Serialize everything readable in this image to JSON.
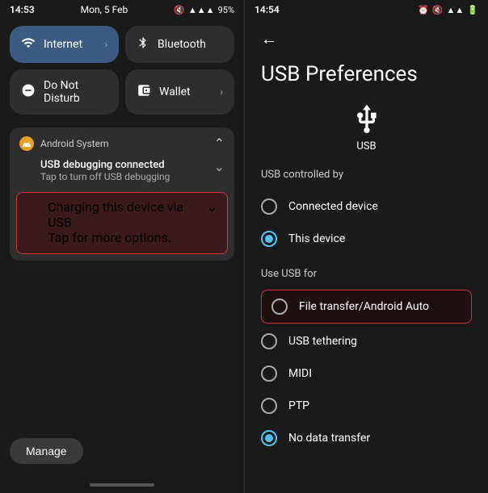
{
  "left": {
    "statusBar": {
      "time": "14:53",
      "date": "Mon, 5 Feb",
      "battery": "95%",
      "icons": "🔇📶🔋"
    },
    "tiles": [
      {
        "id": "internet",
        "icon": "wifi",
        "label": "Internet",
        "arrow": true
      },
      {
        "id": "bluetooth",
        "icon": "bluetooth",
        "label": "Bluetooth",
        "arrow": false
      },
      {
        "id": "donotdisturb",
        "icon": "dnd",
        "label": "Do Not Disturb",
        "arrow": false
      },
      {
        "id": "wallet",
        "icon": "wallet",
        "label": "Wallet",
        "arrow": true
      }
    ],
    "notification": {
      "appName": "Android System",
      "items": [
        {
          "title": "USB debugging connected",
          "subtitle": "Tap to turn off USB debugging"
        },
        {
          "title": "Charging this device via USB",
          "subtitle": "Tap for more options.",
          "highlighted": true
        }
      ]
    },
    "manageLabel": "Manage",
    "homeBar": true
  },
  "right": {
    "statusBar": {
      "time": "14:54",
      "icons": "🔇📶🔋"
    },
    "backLabel": "←",
    "pageTitle": "USB Preferences",
    "usbLabel": "USB",
    "usbControlledBy": "USB controlled by",
    "controlOptions": [
      {
        "label": "Connected device",
        "selected": false
      },
      {
        "label": "This device",
        "selected": true
      }
    ],
    "useUsbFor": "Use USB for",
    "usbOptions": [
      {
        "label": "File transfer/Android Auto",
        "highlighted": true,
        "selected": false
      },
      {
        "label": "USB tethering",
        "highlighted": false,
        "selected": false
      },
      {
        "label": "MIDI",
        "highlighted": false,
        "selected": false
      },
      {
        "label": "PTP",
        "highlighted": false,
        "selected": false
      },
      {
        "label": "No data transfer",
        "highlighted": false,
        "selected": true
      }
    ]
  }
}
